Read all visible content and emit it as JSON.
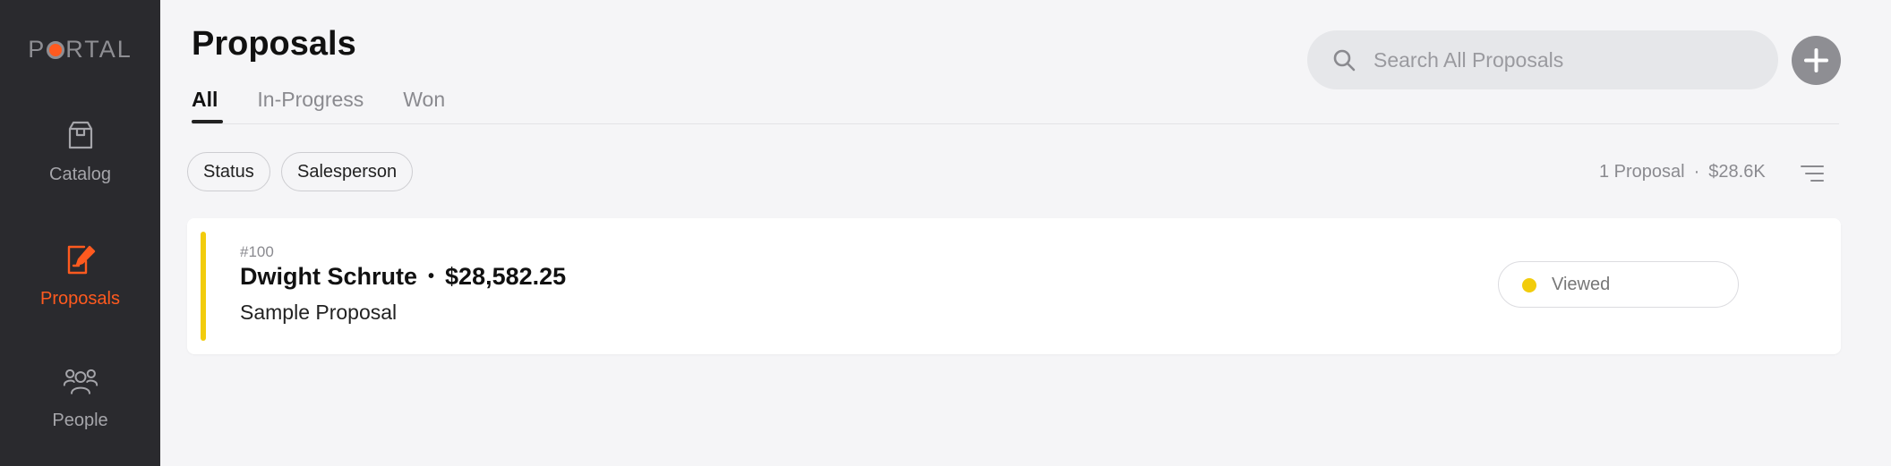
{
  "sidebar": {
    "logo": {
      "text_before": "P",
      "text_after": "RTAL"
    },
    "items": [
      {
        "label": "Catalog",
        "icon": "box-icon",
        "active": false
      },
      {
        "label": "Proposals",
        "icon": "document-edit-icon",
        "active": true
      },
      {
        "label": "People",
        "icon": "people-icon",
        "active": false
      }
    ]
  },
  "header": {
    "title": "Proposals",
    "tabs": [
      {
        "label": "All",
        "active": true
      },
      {
        "label": "In-Progress",
        "active": false
      },
      {
        "label": "Won",
        "active": false
      }
    ],
    "search": {
      "placeholder": "Search All Proposals",
      "value": ""
    }
  },
  "filters": [
    {
      "label": "Status"
    },
    {
      "label": "Salesperson"
    }
  ],
  "summary": {
    "count": "1 Proposal",
    "separator": "·",
    "total": "$28.6K"
  },
  "proposals": [
    {
      "number": "#100",
      "client": "Dwight Schrute",
      "separator": "•",
      "amount": "$28,582.25",
      "name": "Sample Proposal",
      "status": "Viewed",
      "status_color": "#f2cc0c"
    }
  ],
  "colors": {
    "accent": "#ff5a1f",
    "sidebar_bg": "#2a2a2e",
    "status_viewed": "#f2cc0c"
  }
}
